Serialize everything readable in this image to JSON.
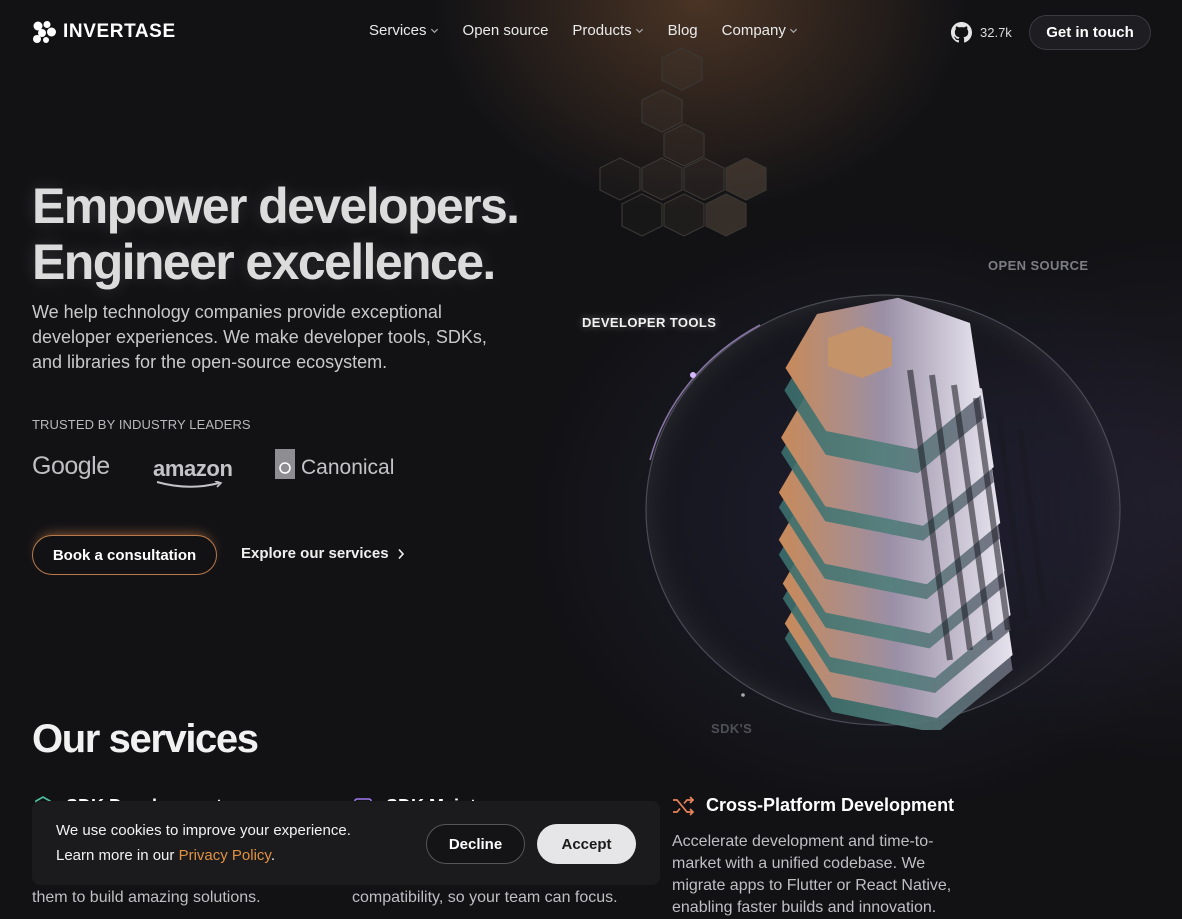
{
  "brand": {
    "name": "INVERTASE"
  },
  "nav": {
    "items": [
      {
        "label": "Services",
        "has_dropdown": true
      },
      {
        "label": "Open source",
        "has_dropdown": false
      },
      {
        "label": "Products",
        "has_dropdown": true
      },
      {
        "label": "Blog",
        "has_dropdown": false
      },
      {
        "label": "Company",
        "has_dropdown": true
      }
    ],
    "github_icon": "github-icon",
    "github_stars": "32.7k",
    "cta_label": "Get in touch"
  },
  "hero": {
    "headline_line1": "Empower developers.",
    "headline_line2": "Engineer excellence.",
    "lead": "We help technology companies provide exceptional developer experiences. We make developer tools, SDKs, and libraries for the open-source ecosystem.",
    "trusted_label": "TRUSTED BY INDUSTRY LEADERS",
    "logos": [
      "Google",
      "amazon",
      "Canonical"
    ],
    "primary_cta": "Book a consultation",
    "secondary_cta": "Explore our services"
  },
  "art": {
    "labels": {
      "developer_tools": "DEVELOPER TOOLS",
      "open_source": "OPEN SOURCE",
      "sdks": "SDK'S"
    }
  },
  "services": {
    "title": "Our services",
    "items": [
      {
        "title": "SDK Development",
        "icon": "sdk-icon",
        "desc": "seamlessly into your platform, inspiring them to build amazing solutions."
      },
      {
        "title": "SDK Maintenance",
        "icon": "maintenance-icon",
        "desc": "services, handling updates, fixes, and compatibility, so your team can focus."
      },
      {
        "title": "Cross-Platform Development",
        "icon": "shuffle-icon",
        "desc": "Accelerate development and time-to-market with a unified codebase. We migrate apps to Flutter or React Native, enabling faster builds and innovation."
      }
    ]
  },
  "cookie": {
    "line1": "We use cookies to improve your experience.",
    "line2_prefix": "Learn more in our ",
    "link": "Privacy Policy",
    "line2_suffix": ".",
    "decline": "Decline",
    "accept": "Accept"
  },
  "colors": {
    "accent_orange": "#e0913f",
    "background": "#121215"
  }
}
